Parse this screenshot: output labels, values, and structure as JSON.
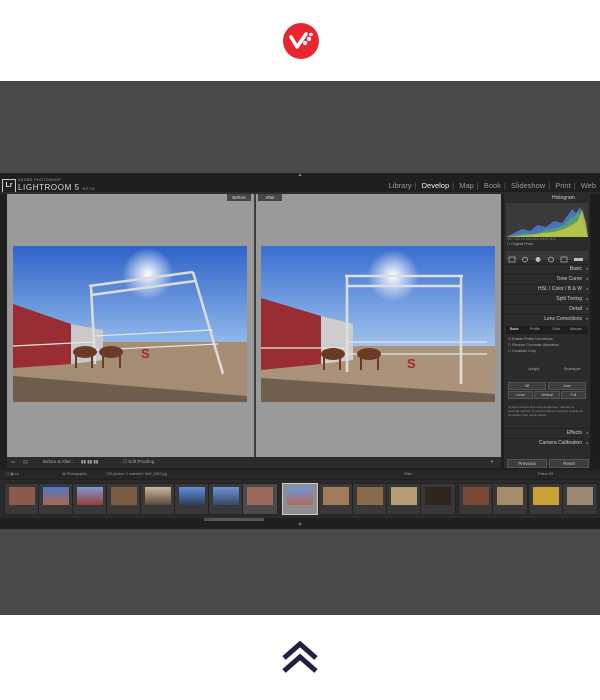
{
  "app": {
    "badge": "Lr",
    "brand_sub": "ADOBE PHOTOSHOP",
    "brand_title": "LIGHTROOM 5",
    "brand_beta": "BETA"
  },
  "modules": [
    "Library",
    "Develop",
    "Map",
    "Book",
    "Slideshow",
    "Print",
    "Web"
  ],
  "active_module": "Develop",
  "view": {
    "before_label": "Before",
    "after_label": "After"
  },
  "panel": {
    "histogram_title": "Histogram",
    "hist_meta": "ISO 100   16 MM   f/14   1/400 SEC",
    "original_photo": "Original Photo",
    "sections": {
      "basic": "Basic",
      "tone_curve": "Tone Curve",
      "hsl": "HSL / Color / B & W",
      "split_toning": "Split Toning",
      "detail": "Detail",
      "lens_corrections": "Lens Corrections",
      "effects": "Effects",
      "camera_calibration": "Camera Calibration"
    },
    "lens_tabs": [
      "Basic",
      "Profile",
      "Color",
      "Manual"
    ],
    "lens_checks": [
      "Enable Profile Corrections",
      "Remove Chromatic Aberration",
      "Constrain Crop"
    ],
    "upright_label": "Upright",
    "reanalyze_label": "Reanalyze",
    "upright_buttons": [
      "Off",
      "Auto",
      "Level",
      "Vertical",
      "Full"
    ],
    "upright_note": "Upright corrects lens and perspective. Transforms currently applied. To correct without cropping, enable the Constrain Crop option above."
  },
  "toolbar": {
    "before_after_label": "Before & After :",
    "soft_proofing": "Soft Proofing"
  },
  "buttons": {
    "previous": "Previous",
    "reset": "Reset"
  },
  "filmstrip_header": {
    "source": "All Photographs",
    "count": "129 photos / 1 selected / IMG_6057.jpg",
    "filter_label": "Filter :",
    "filters_off": "Filters Off"
  },
  "colors": {
    "accent_logo": "#e8262d",
    "up_arrows": "#241f45"
  },
  "icons": {
    "logo": "heart-check-logo-icon",
    "scroll_up": "double-chevron-up-icon"
  }
}
